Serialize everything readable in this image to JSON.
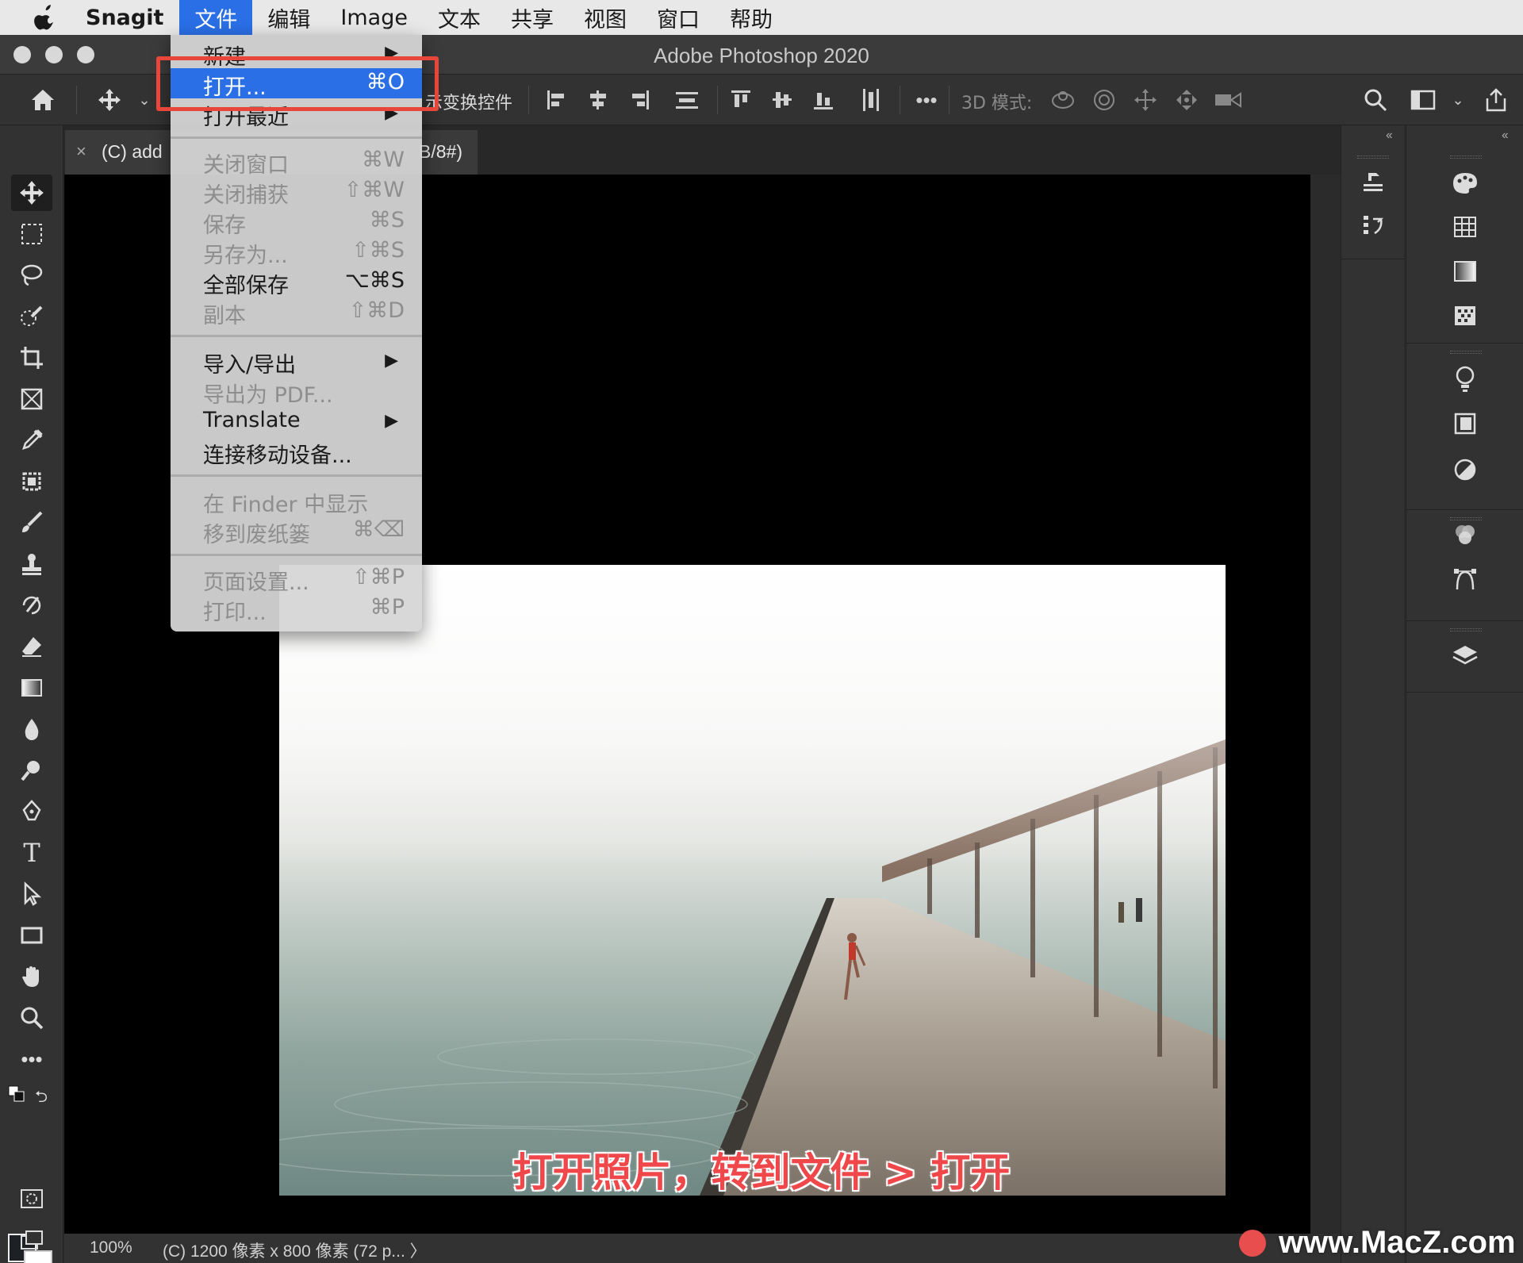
{
  "menubar": {
    "app_name": "Snagit",
    "items": [
      "文件",
      "编辑",
      "Image",
      "文本",
      "共享",
      "视图",
      "窗口",
      "帮助"
    ],
    "active_index": 0
  },
  "window": {
    "title": "Adobe Photoshop 2020"
  },
  "options_bar": {
    "transform_label": "示变换控件",
    "mode_label": "3D 模式:"
  },
  "document_tab": {
    "close": "×",
    "name_left": "(C) add",
    "name_right": "B/8#)"
  },
  "file_menu": {
    "items": [
      {
        "label": "新建",
        "shortcut": "",
        "submenu": true,
        "disabled": false
      },
      {
        "label": "打开...",
        "shortcut": "⌘O",
        "submenu": false,
        "disabled": false,
        "highlighted": true
      },
      {
        "label": "打开最近",
        "shortcut": "",
        "submenu": true,
        "disabled": false
      },
      {
        "label": "关闭窗口",
        "shortcut": "⌘W",
        "submenu": false,
        "disabled": true
      },
      {
        "label": "关闭捕获",
        "shortcut": "⇧⌘W",
        "submenu": false,
        "disabled": true
      },
      {
        "label": "保存",
        "shortcut": "⌘S",
        "submenu": false,
        "disabled": true
      },
      {
        "label": "另存为...",
        "shortcut": "⇧⌘S",
        "submenu": false,
        "disabled": true
      },
      {
        "label": "全部保存",
        "shortcut": "⌥⌘S",
        "submenu": false,
        "disabled": false
      },
      {
        "label": "副本",
        "shortcut": "⇧⌘D",
        "submenu": false,
        "disabled": true
      },
      {
        "label": "导入/导出",
        "shortcut": "",
        "submenu": true,
        "disabled": false
      },
      {
        "label": "导出为 PDF...",
        "shortcut": "",
        "submenu": false,
        "disabled": true
      },
      {
        "label": "Translate",
        "shortcut": "",
        "submenu": true,
        "disabled": false
      },
      {
        "label": "连接移动设备...",
        "shortcut": "",
        "submenu": false,
        "disabled": false
      },
      {
        "label": "在 Finder 中显示",
        "shortcut": "",
        "submenu": false,
        "disabled": true
      },
      {
        "label": "移到废纸篓",
        "shortcut": "⌘⌫",
        "submenu": false,
        "disabled": true
      },
      {
        "label": "页面设置...",
        "shortcut": "⇧⌘P",
        "submenu": false,
        "disabled": true
      },
      {
        "label": "打印...",
        "shortcut": "⌘P",
        "submenu": false,
        "disabled": true
      }
    ],
    "arrow": "▶"
  },
  "caption": "打开照片，转到文件 > 打开",
  "status_bar": {
    "zoom": "100%",
    "info": "(C) 1200 像素 x 800 像素 (72 p...  〉"
  },
  "watermark": "www.MacZ.com",
  "colors": {
    "highlight": "#2a6fe6",
    "annotation_red": "#e8463a",
    "caption_red": "#f0474a"
  }
}
